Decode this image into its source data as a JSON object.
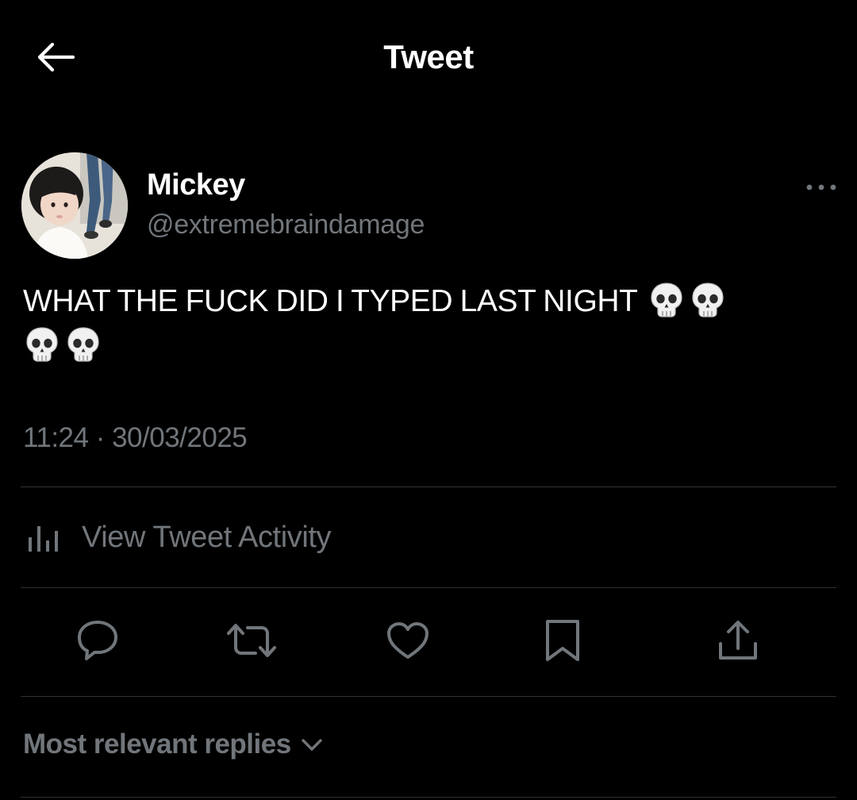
{
  "header": {
    "title": "Tweet",
    "back_icon": "arrow-left-icon"
  },
  "author": {
    "name": "Mickey",
    "handle": "@extremebraindamage",
    "avatar": "child-photo-avatar"
  },
  "tweet": {
    "text": "WHAT THE FUCK DID I TYPED LAST NIGHT",
    "emojis": [
      "skull",
      "skull",
      "skull",
      "skull"
    ],
    "timestamp": "11:24 · 30/03/2025"
  },
  "activity": {
    "label": "View Tweet Activity",
    "icon": "bar-chart-icon"
  },
  "actions": [
    {
      "name": "reply",
      "icon": "reply-icon"
    },
    {
      "name": "retweet",
      "icon": "retweet-icon"
    },
    {
      "name": "like",
      "icon": "heart-icon"
    },
    {
      "name": "bookmark",
      "icon": "bookmark-icon"
    },
    {
      "name": "share",
      "icon": "share-icon"
    }
  ],
  "replies": {
    "sort_label": "Most relevant replies"
  },
  "colors": {
    "background": "#000000",
    "primary_text": "#ffffff",
    "secondary_text": "#71767b",
    "divider": "#2f3336"
  }
}
